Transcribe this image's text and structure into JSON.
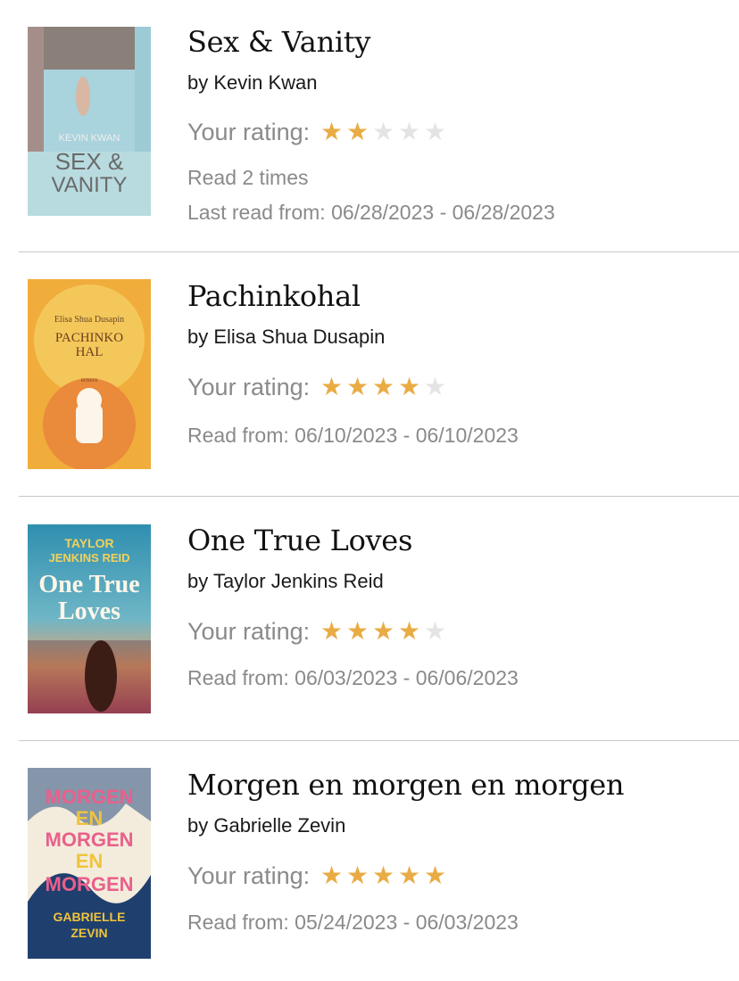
{
  "rating_label": "Your rating:",
  "colors": {
    "star_on": "#e9ac44",
    "star_off": "#e4e4e4",
    "secondary_text": "#8a8a8a"
  },
  "books": [
    {
      "title": "Sex & Vanity",
      "author": "by Kevin Kwan",
      "rating": 2,
      "max_rating": 5,
      "read_count": "Read 2 times",
      "read_dates": "Last read from: 06/28/2023 - 06/28/2023",
      "cover": {
        "text": [
          "KEVIN KWAN",
          "SEX &",
          "VANITY"
        ]
      }
    },
    {
      "title": "Pachinkohal",
      "author": "by Elisa Shua Dusapin",
      "rating": 4,
      "max_rating": 5,
      "read_dates": "Read from: 06/10/2023 - 06/10/2023",
      "cover": {
        "text": [
          "Elisa Shua Dusapin",
          "PACHINKO",
          "HAL",
          "ROMAN"
        ]
      }
    },
    {
      "title": "One True Loves",
      "author": "by Taylor Jenkins Reid",
      "rating": 4,
      "max_rating": 5,
      "read_dates": "Read from: 06/03/2023 - 06/06/2023",
      "cover": {
        "text": [
          "TAYLOR",
          "JENKINS REID",
          "One True",
          "Loves"
        ]
      }
    },
    {
      "title": "Morgen en morgen en morgen",
      "author": "by Gabrielle Zevin",
      "rating": 5,
      "max_rating": 5,
      "read_dates": "Read from: 05/24/2023 - 06/03/2023",
      "cover": {
        "text": [
          "MORGEN",
          "EN",
          "MORGEN",
          "EN",
          "MORGEN",
          "GABRIELLE",
          "ZEVIN"
        ]
      }
    }
  ]
}
